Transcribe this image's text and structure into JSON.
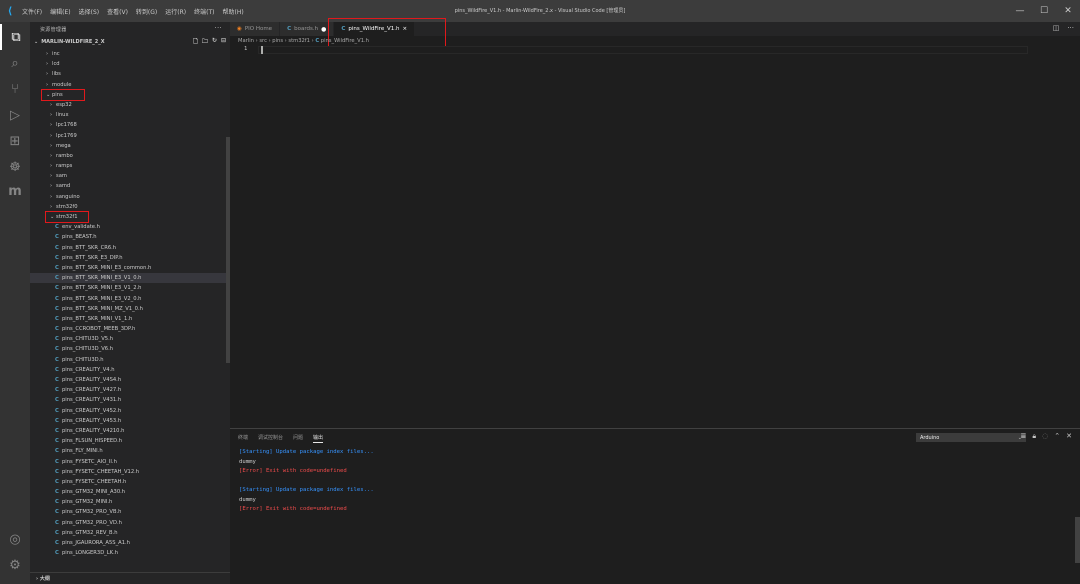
{
  "titlebar": {
    "menus": [
      "文件(F)",
      "编辑(E)",
      "选择(S)",
      "查看(V)",
      "转到(G)",
      "运行(R)",
      "终端(T)",
      "帮助(H)"
    ],
    "window_title": "pins_WildFire_V1.h - Marlin-WildFire_2.x - Visual Studio Code [管理员]",
    "controls": [
      "—",
      "☐",
      "✕"
    ]
  },
  "sidebar": {
    "title": "资源管理器",
    "more": "···",
    "folder": "MARLIN-WILDFIRE_2_X",
    "tree": [
      {
        "label": "inc",
        "type": "folder",
        "depth": 1
      },
      {
        "label": "lcd",
        "type": "folder",
        "depth": 1
      },
      {
        "label": "libs",
        "type": "folder",
        "depth": 1
      },
      {
        "label": "module",
        "type": "folder",
        "depth": 1
      },
      {
        "label": "pins",
        "type": "folder-open",
        "depth": 1
      },
      {
        "label": "esp32",
        "type": "folder",
        "depth": 2
      },
      {
        "label": "linux",
        "type": "folder",
        "depth": 2
      },
      {
        "label": "lpc1768",
        "type": "folder",
        "depth": 2
      },
      {
        "label": "lpc1769",
        "type": "folder",
        "depth": 2
      },
      {
        "label": "mega",
        "type": "folder",
        "depth": 2
      },
      {
        "label": "rambo",
        "type": "folder",
        "depth": 2
      },
      {
        "label": "ramps",
        "type": "folder",
        "depth": 2
      },
      {
        "label": "sam",
        "type": "folder",
        "depth": 2
      },
      {
        "label": "samd",
        "type": "folder",
        "depth": 2
      },
      {
        "label": "sanguino",
        "type": "folder",
        "depth": 2
      },
      {
        "label": "stm32f0",
        "type": "folder",
        "depth": 2
      },
      {
        "label": "stm32f1",
        "type": "folder-open",
        "depth": 2
      },
      {
        "label": "env_validate.h",
        "type": "file",
        "depth": 3
      },
      {
        "label": "pins_BEAST.h",
        "type": "file",
        "depth": 3
      },
      {
        "label": "pins_BTT_SKR_CR6.h",
        "type": "file",
        "depth": 3
      },
      {
        "label": "pins_BTT_SKR_E3_DIP.h",
        "type": "file",
        "depth": 3
      },
      {
        "label": "pins_BTT_SKR_MINI_E3_common.h",
        "type": "file",
        "depth": 3
      },
      {
        "label": "pins_BTT_SKR_MINI_E3_V1_0.h",
        "type": "file",
        "depth": 3,
        "selected": true
      },
      {
        "label": "pins_BTT_SKR_MINI_E3_V1_2.h",
        "type": "file",
        "depth": 3
      },
      {
        "label": "pins_BTT_SKR_MINI_E3_V2_0.h",
        "type": "file",
        "depth": 3
      },
      {
        "label": "pins_BTT_SKR_MINI_MZ_V1_0.h",
        "type": "file",
        "depth": 3
      },
      {
        "label": "pins_BTT_SKR_MINI_V1_1.h",
        "type": "file",
        "depth": 3
      },
      {
        "label": "pins_CCROBOT_MEEB_3DP.h",
        "type": "file",
        "depth": 3
      },
      {
        "label": "pins_CHITU3D_V5.h",
        "type": "file",
        "depth": 3
      },
      {
        "label": "pins_CHITU3D_V6.h",
        "type": "file",
        "depth": 3
      },
      {
        "label": "pins_CHITU3D.h",
        "type": "file",
        "depth": 3
      },
      {
        "label": "pins_CREALITY_V4.h",
        "type": "file",
        "depth": 3
      },
      {
        "label": "pins_CREALITY_V4S4.h",
        "type": "file",
        "depth": 3
      },
      {
        "label": "pins_CREALITY_V427.h",
        "type": "file",
        "depth": 3
      },
      {
        "label": "pins_CREALITY_V431.h",
        "type": "file",
        "depth": 3
      },
      {
        "label": "pins_CREALITY_V452.h",
        "type": "file",
        "depth": 3
      },
      {
        "label": "pins_CREALITY_V453.h",
        "type": "file",
        "depth": 3
      },
      {
        "label": "pins_CREALITY_V4210.h",
        "type": "file",
        "depth": 3
      },
      {
        "label": "pins_FLSUN_HISPEED.h",
        "type": "file",
        "depth": 3
      },
      {
        "label": "pins_FLY_MINI.h",
        "type": "file",
        "depth": 3
      },
      {
        "label": "pins_FYSETC_AIO_II.h",
        "type": "file",
        "depth": 3
      },
      {
        "label": "pins_FYSETC_CHEETAH_V12.h",
        "type": "file",
        "depth": 3
      },
      {
        "label": "pins_FYSETC_CHEETAH.h",
        "type": "file",
        "depth": 3
      },
      {
        "label": "pins_GTM32_MINI_A30.h",
        "type": "file",
        "depth": 3
      },
      {
        "label": "pins_GTM32_MINI.h",
        "type": "file",
        "depth": 3
      },
      {
        "label": "pins_GTM32_PRO_VB.h",
        "type": "file",
        "depth": 3
      },
      {
        "label": "pins_GTM32_PRO_VD.h",
        "type": "file",
        "depth": 3
      },
      {
        "label": "pins_GTM32_REV_B.h",
        "type": "file",
        "depth": 3
      },
      {
        "label": "pins_JGAURORA_A5S_A1.h",
        "type": "file",
        "depth": 3
      },
      {
        "label": "pins_LONGER3D_LK.h",
        "type": "file",
        "depth": 3
      }
    ],
    "outline_label": "大纲"
  },
  "tabs": [
    {
      "label": "PIO Home",
      "icon": "platformio-icon",
      "active": false
    },
    {
      "label": "boards.h",
      "icon": "c-file-icon",
      "active": false,
      "dirty": true
    },
    {
      "label": "pins_WildFire_V1.h",
      "icon": "c-file-icon",
      "active": true,
      "close": "×"
    }
  ],
  "breadcrumb": {
    "parts": [
      "Marlin",
      "src",
      "pins",
      "stm32f1"
    ],
    "file_icon": "C",
    "file": "pins_WildFire_V1.h"
  },
  "editor": {
    "line_numbers": [
      "1"
    ]
  },
  "panel": {
    "tabs": [
      "终端",
      "调试控制台",
      "问题",
      "输出"
    ],
    "active_tab": "输出",
    "select_value": "Arduino",
    "output": [
      {
        "text": "[Starting] Update package index files...",
        "kind": "info"
      },
      {
        "text": "dummy",
        "kind": "plain"
      },
      {
        "text": "[Error] Exit with code=undefined",
        "kind": "error"
      },
      {
        "text": "",
        "kind": "blank"
      },
      {
        "text": "[Starting] Update package index files...",
        "kind": "info"
      },
      {
        "text": "dummy",
        "kind": "plain"
      },
      {
        "text": "[Error] Exit with code=undefined",
        "kind": "error"
      }
    ]
  },
  "colors": {
    "highlight": "#e0191c",
    "accent_c": "#519aba",
    "error": "#f14c4c",
    "info": "#3794ff"
  }
}
